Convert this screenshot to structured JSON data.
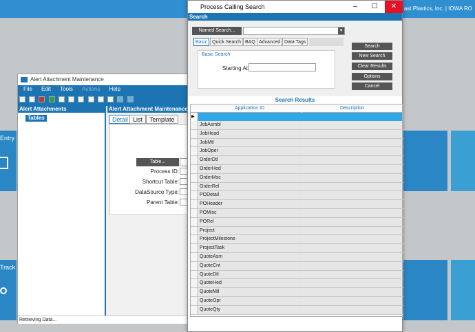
{
  "background_app": {
    "company_text": "ast Plastics, Inc.  |  IOWA RO",
    "tile_entry_label": "Entry",
    "tile_track_label": "Track"
  },
  "alert_window": {
    "title": "Alert Attachment Maintenance",
    "menu": [
      "File",
      "Edit",
      "Tools",
      "Actions",
      "Help"
    ],
    "left_pane_header": "Alert Attachments",
    "tree_node": "Tables",
    "right_pane_header": "Alert Attachment Maintenance",
    "tabs": [
      "Detail",
      "List",
      "Template"
    ],
    "table_button": "Table...",
    "fields": [
      "Process ID:",
      "Shortcut Table:",
      "DataSource Type:",
      "Parent Table:"
    ],
    "status": "Retrieving Data..."
  },
  "pcs_window": {
    "title": "Process Calling Search",
    "search_header": "Search",
    "named_search_button": "Named Search...",
    "named_search_value": "",
    "tabs": [
      "Basic",
      "Quick Search",
      "BAQ",
      "Advanced",
      "Data Tags"
    ],
    "basic_search_title": "Basic Search",
    "starting_at_label": "Starting At:",
    "starting_at_value": "",
    "buttons": [
      "Search",
      "New Search",
      "Clear Results",
      "Options",
      "Cancel"
    ],
    "results_header": "Search Results",
    "columns": [
      "Application ID",
      "Description"
    ],
    "rows": [
      "JobAsmbl",
      "JobHead",
      "JobMtl",
      "JobOper",
      "OrderDtl",
      "OrderHed",
      "OrderMsc",
      "OrderRel",
      "PODetail",
      "POHeader",
      "POMisc",
      "PORel",
      "Project",
      "ProjectMilestone",
      "ProjectTask",
      "QuoteAsm",
      "QuoteCnt",
      "QuoteDtl",
      "QuoteHed",
      "QuoteMtl",
      "QuoteOpr",
      "QuoteQty"
    ]
  },
  "colors": {
    "accent": "#1d74b3",
    "selection": "#2fa9e8",
    "close": "#e81123"
  }
}
